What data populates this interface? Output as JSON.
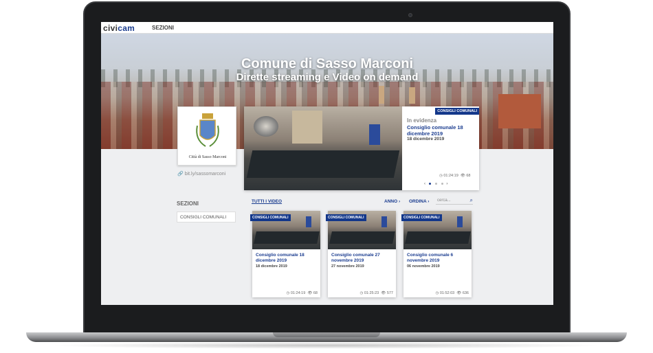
{
  "topbar": {
    "logo_main": "civi",
    "logo_accent": "cam",
    "menu_label": "SEZIONI"
  },
  "hero": {
    "title": "Comune di Sasso Marconi",
    "subtitle": "Dirette streaming e Video on demand"
  },
  "profile": {
    "name": "Città di Sasso Marconi",
    "link": "bit.ly/sassomarconi"
  },
  "featured": {
    "badge": "CONSIGLI COMUNALI",
    "label": "In evidenza",
    "title": "Consiglio comunale 18 dicembre 2019",
    "date": "18 dicembre 2019",
    "duration": "01:24:19",
    "views": "68",
    "prev": "‹",
    "next": "›"
  },
  "sidebar": {
    "title": "SEZIONI",
    "items": [
      {
        "label": "CONSIGLI COMUNALI"
      }
    ]
  },
  "filters": {
    "all": "TUTTI I VIDEO",
    "year": "ANNO",
    "order": "ORDINA",
    "search_placeholder": "cerca..."
  },
  "videos": [
    {
      "badge": "CONSIGLI COMUNALI",
      "title": "Consiglio comunale 18 dicembre 2019",
      "date": "18 dicembre 2019",
      "duration": "01:24:19",
      "views": "68"
    },
    {
      "badge": "CONSIGLI COMUNALI",
      "title": "Consiglio comunale 27 novembre 2019",
      "date": "27 novembre 2019",
      "duration": "01:25:23",
      "views": "577"
    },
    {
      "badge": "CONSIGLI COMUNALI",
      "title": "Consiglio comunale 6 novembre 2019",
      "date": "06 novembre 2019",
      "duration": "01:52:03",
      "views": "636"
    }
  ],
  "colors": {
    "accent": "#1a3c8f",
    "badge": "#13378a"
  }
}
